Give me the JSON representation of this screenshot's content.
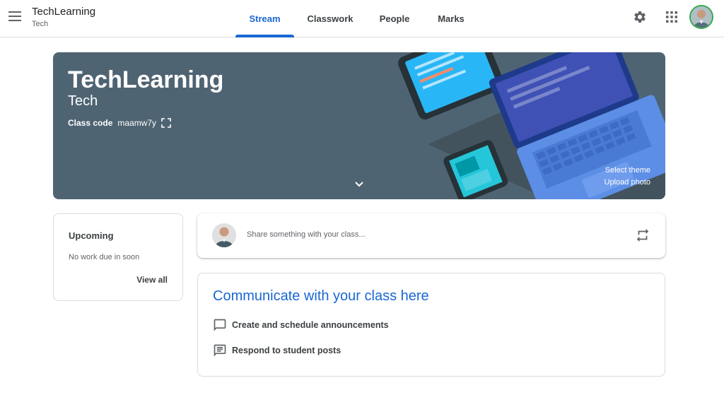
{
  "header": {
    "class_name": "TechLearning",
    "class_section": "Tech",
    "tabs": [
      {
        "label": "Stream",
        "active": true
      },
      {
        "label": "Classwork",
        "active": false
      },
      {
        "label": "People",
        "active": false
      },
      {
        "label": "Marks",
        "active": false
      }
    ],
    "icons": [
      "menu-icon",
      "gear-icon",
      "apps-grid-icon"
    ]
  },
  "banner": {
    "title": "TechLearning",
    "subtitle": "Tech",
    "class_code_label": "Class code",
    "class_code": "maamw7y",
    "select_theme": "Select theme",
    "upload_photo": "Upload photo",
    "background_color": "#4f6472"
  },
  "upcoming": {
    "title": "Upcoming",
    "text": "No work due in soon",
    "view_all": "View all"
  },
  "share": {
    "placeholder": "Share something with your class..."
  },
  "communicate": {
    "title": "Communicate with your class here",
    "items": [
      {
        "label": "Create and schedule announcements",
        "icon": "announcement-icon"
      },
      {
        "label": "Respond to student posts",
        "icon": "chat-icon"
      }
    ]
  },
  "colors": {
    "accent": "#1967d2",
    "divider": "#dadce0"
  }
}
